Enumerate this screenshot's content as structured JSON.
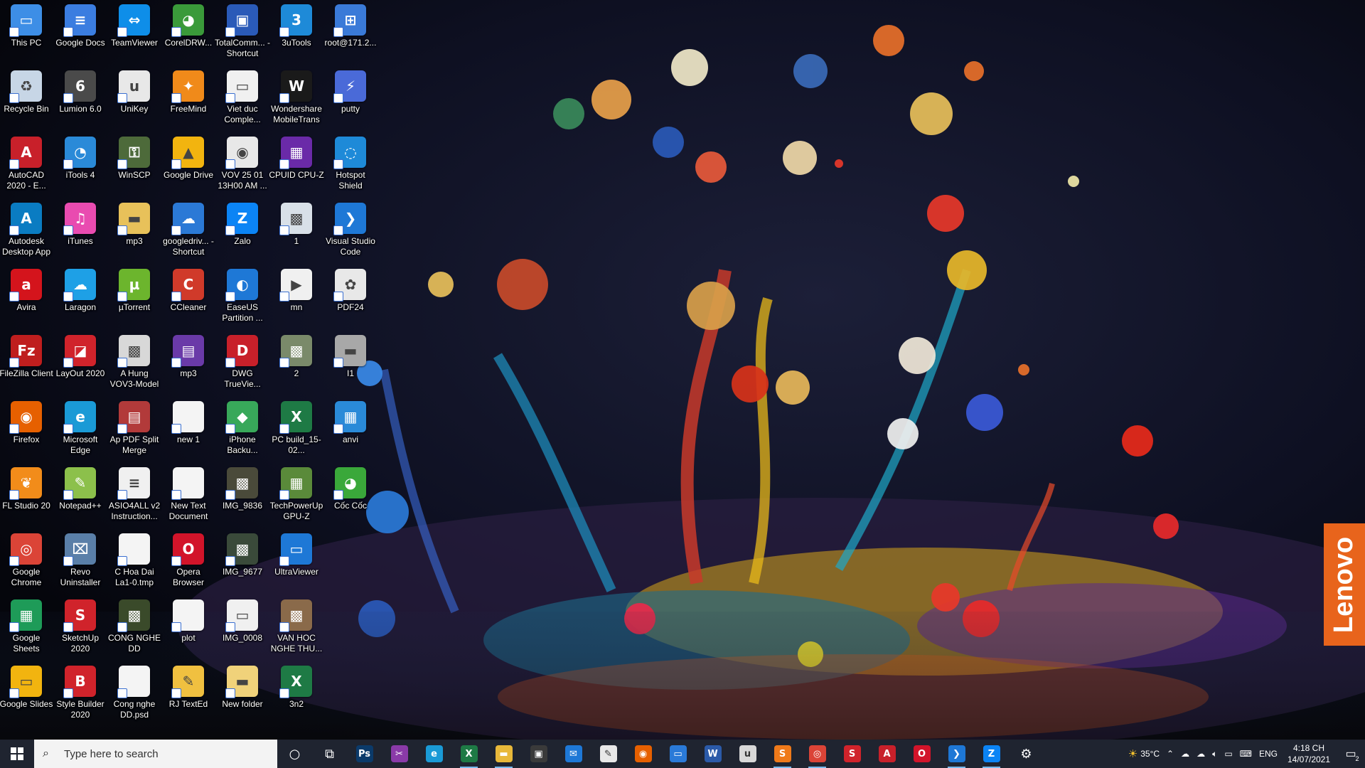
{
  "desktop": {
    "columns": [
      [
        {
          "label": "This PC",
          "icon": "this-pc-icon",
          "color": "#3d8ee6",
          "glyph": "▭"
        },
        {
          "label": "Recycle Bin",
          "icon": "recycle-bin-icon",
          "color": "#c7d6e6",
          "glyph": "♻"
        },
        {
          "label": "AutoCAD 2020 - E...",
          "icon": "autocad-icon",
          "color": "#c8202a",
          "glyph": "A"
        },
        {
          "label": "Autodesk Desktop App",
          "icon": "autodesk-icon",
          "color": "#0a7cc2",
          "glyph": "A"
        },
        {
          "label": "Avira",
          "icon": "avira-icon",
          "color": "#d4141c",
          "glyph": "a"
        },
        {
          "label": "FileZilla Client",
          "icon": "filezilla-icon",
          "color": "#bf1e1e",
          "glyph": "Fz"
        },
        {
          "label": "Firefox",
          "icon": "firefox-icon",
          "color": "#e66000",
          "glyph": "◉"
        },
        {
          "label": "FL Studio 20",
          "icon": "fl-studio-icon",
          "color": "#f28c1a",
          "glyph": "❦"
        },
        {
          "label": "Google Chrome",
          "icon": "chrome-icon",
          "color": "#db4437",
          "glyph": "◎"
        },
        {
          "label": "Google Sheets",
          "icon": "google-sheets-icon",
          "color": "#1e9b58",
          "glyph": "▦"
        },
        {
          "label": "Google Slides",
          "icon": "google-slides-icon",
          "color": "#f2b40f",
          "glyph": "▭"
        }
      ],
      [
        {
          "label": "Google Docs",
          "icon": "google-docs-icon",
          "color": "#3b7de0",
          "glyph": "≡"
        },
        {
          "label": "Lumion 6.0",
          "icon": "lumion-icon",
          "color": "#4a4a4a",
          "glyph": "6"
        },
        {
          "label": "iTools 4",
          "icon": "itools-icon",
          "color": "#2a8ad8",
          "glyph": "◔"
        },
        {
          "label": "iTunes",
          "icon": "itunes-icon",
          "color": "#e94bb0",
          "glyph": "♫"
        },
        {
          "label": "Laragon",
          "icon": "laragon-icon",
          "color": "#1ea0e6",
          "glyph": "☁"
        },
        {
          "label": "LayOut 2020",
          "icon": "layout-icon",
          "color": "#d0232b",
          "glyph": "◪"
        },
        {
          "label": "Microsoft Edge",
          "icon": "edge-icon",
          "color": "#1a9ad6",
          "glyph": "e"
        },
        {
          "label": "Notepad++",
          "icon": "notepadpp-icon",
          "color": "#8cc04b",
          "glyph": "✎"
        },
        {
          "label": "Revo Uninstaller",
          "icon": "revo-icon",
          "color": "#5a7fa8",
          "glyph": "⌧"
        },
        {
          "label": "SketchUp 2020",
          "icon": "sketchup-icon",
          "color": "#d0232b",
          "glyph": "S"
        },
        {
          "label": "Style Builder 2020",
          "icon": "style-builder-icon",
          "color": "#d0232b",
          "glyph": "B"
        }
      ],
      [
        {
          "label": "TeamViewer",
          "icon": "teamviewer-icon",
          "color": "#0e8ee9",
          "glyph": "⇔"
        },
        {
          "label": "UniKey",
          "icon": "unikey-icon",
          "color": "#e8e8e8",
          "glyph": "u"
        },
        {
          "label": "WinSCP",
          "icon": "winscp-icon",
          "color": "#4d6a3a",
          "glyph": "⚿"
        },
        {
          "label": "mp3",
          "icon": "folder-icon",
          "color": "#e8c15a",
          "glyph": "▬"
        },
        {
          "label": "µTorrent",
          "icon": "utorrent-icon",
          "color": "#6cb52d",
          "glyph": "µ"
        },
        {
          "label": "A Hung VOV3-Model",
          "icon": "image-file-icon",
          "color": "#d8d8d8",
          "glyph": "▩"
        },
        {
          "label": "Ap PDF Split Merge",
          "icon": "pdf-split-icon",
          "color": "#b23a3a",
          "glyph": "▤"
        },
        {
          "label": "ASIO4ALL v2 Instruction...",
          "icon": "document-icon",
          "color": "#f0f0f0",
          "glyph": "≡"
        },
        {
          "label": "C Hoa Dai La1-0.tmp",
          "icon": "file-icon",
          "color": "#f4f4f4",
          "glyph": " "
        },
        {
          "label": "CONG NGHE DD",
          "icon": "image-file-icon",
          "color": "#3a4a2a",
          "glyph": "▩"
        },
        {
          "label": "Cong nghe DD.psd",
          "icon": "file-icon",
          "color": "#f4f4f4",
          "glyph": " "
        }
      ],
      [
        {
          "label": "CorelDRW...",
          "icon": "coreldraw-icon",
          "color": "#3a9a3a",
          "glyph": "◕"
        },
        {
          "label": "FreeMind",
          "icon": "freemind-icon",
          "color": "#f08a1a",
          "glyph": "✦"
        },
        {
          "label": "Google Drive",
          "icon": "google-drive-icon",
          "color": "#f2b40f",
          "glyph": "▲"
        },
        {
          "label": "googledriv... - Shortcut",
          "icon": "cloud-icon",
          "color": "#2b79d6",
          "glyph": "☁"
        },
        {
          "label": "CCleaner",
          "icon": "ccleaner-icon",
          "color": "#d03a2a",
          "glyph": "C"
        },
        {
          "label": "mp3",
          "icon": "winrar-icon",
          "color": "#6a3aa8",
          "glyph": "▤"
        },
        {
          "label": "new 1",
          "icon": "file-icon",
          "color": "#f4f4f4",
          "glyph": " "
        },
        {
          "label": "New Text Document",
          "icon": "file-icon",
          "color": "#f4f4f4",
          "glyph": " "
        },
        {
          "label": "Opera Browser",
          "icon": "opera-icon",
          "color": "#d2142a",
          "glyph": "O"
        },
        {
          "label": "plot",
          "icon": "file-icon",
          "color": "#f4f4f4",
          "glyph": " "
        },
        {
          "label": "RJ TextEd",
          "icon": "rj-texted-icon",
          "color": "#f0c040",
          "glyph": "✎"
        }
      ],
      [
        {
          "label": "TotalComm... - Shortcut",
          "icon": "total-commander-icon",
          "color": "#2a5ab8",
          "glyph": "▣"
        },
        {
          "label": "Viet duc Comple...",
          "icon": "image-file-icon",
          "color": "#f0f0f0",
          "glyph": "▭"
        },
        {
          "label": "VOV 25 01 13H00 AM ...",
          "icon": "audio-file-icon",
          "color": "#e8e8e8",
          "glyph": "◉"
        },
        {
          "label": "Zalo",
          "icon": "zalo-icon",
          "color": "#0b84f5",
          "glyph": "Z"
        },
        {
          "label": "EaseUS Partition ...",
          "icon": "easeus-icon",
          "color": "#1e78d6",
          "glyph": "◐"
        },
        {
          "label": "DWG TrueVie...",
          "icon": "dwg-trueview-icon",
          "color": "#c8202a",
          "glyph": "D"
        },
        {
          "label": "iPhone Backu...",
          "icon": "iphone-backup-icon",
          "color": "#38a85a",
          "glyph": "◆"
        },
        {
          "label": "IMG_9836",
          "icon": "image-file-icon",
          "color": "#4a4a3a",
          "glyph": "▩"
        },
        {
          "label": "IMG_9677",
          "icon": "image-file-icon",
          "color": "#3a4a3a",
          "glyph": "▩"
        },
        {
          "label": "IMG_0008",
          "icon": "image-file-icon",
          "color": "#f0f0f0",
          "glyph": "▭"
        },
        {
          "label": "New folder",
          "icon": "folder-icon",
          "color": "#f0d27a",
          "glyph": "▬"
        }
      ],
      [
        {
          "label": "3uTools",
          "icon": "3utools-icon",
          "color": "#1e8ad8",
          "glyph": "3"
        },
        {
          "label": "Wondershare MobileTrans",
          "icon": "mobiletrans-icon",
          "color": "#1a1a1a",
          "glyph": "W"
        },
        {
          "label": "CPUID CPU-Z",
          "icon": "cpu-z-icon",
          "color": "#6a2aa8",
          "glyph": "▦"
        },
        {
          "label": "1",
          "icon": "image-file-icon",
          "color": "#d8e0e8",
          "glyph": "▩"
        },
        {
          "label": "mn",
          "icon": "video-file-icon",
          "color": "#f0f0f0",
          "glyph": "▶"
        },
        {
          "label": "2",
          "icon": "image-file-icon",
          "color": "#7a8a6a",
          "glyph": "▩"
        },
        {
          "label": "PC build_15-02...",
          "icon": "excel-file-icon",
          "color": "#1e7a45",
          "glyph": "X"
        },
        {
          "label": "TechPowerUp GPU-Z",
          "icon": "gpu-z-icon",
          "color": "#5a8a3a",
          "glyph": "▦"
        },
        {
          "label": "UltraViewer",
          "icon": "ultraviewer-icon",
          "color": "#1e78d6",
          "glyph": "▭"
        },
        {
          "label": "VAN HOC NGHE THU...",
          "icon": "image-file-icon",
          "color": "#8a6a4a",
          "glyph": "▩"
        },
        {
          "label": "3n2",
          "icon": "excel-file-icon",
          "color": "#1e7a45",
          "glyph": "X"
        }
      ],
      [
        {
          "label": "root@171.2...",
          "icon": "network-icon",
          "color": "#3a7ad8",
          "glyph": "⊞"
        },
        {
          "label": "putty",
          "icon": "putty-icon",
          "color": "#4a6ad8",
          "glyph": "⚡"
        },
        {
          "label": "Hotspot Shield",
          "icon": "hotspot-shield-icon",
          "color": "#1e8ad8",
          "glyph": "◌"
        },
        {
          "label": "Visual Studio Code",
          "icon": "vscode-icon",
          "color": "#1e78d6",
          "glyph": "❯"
        },
        {
          "label": "PDF24",
          "icon": "pdf24-icon",
          "color": "#e8e8e8",
          "glyph": "✿"
        },
        {
          "label": "I1",
          "icon": "image-file-icon",
          "color": "#a8a8a8",
          "glyph": "▬"
        },
        {
          "label": "anvi",
          "icon": "anvi-icon",
          "color": "#2a8ad8",
          "glyph": "▦"
        },
        {
          "label": "Cốc Cốc",
          "icon": "coccoc-icon",
          "color": "#3aa83a",
          "glyph": "◕"
        }
      ]
    ]
  },
  "lenovo": {
    "text": "Lenovo"
  },
  "taskbar": {
    "search_placeholder": "Type here to search",
    "apps": [
      {
        "name": "cortana-icon",
        "glyph": "○",
        "color": "transparent"
      },
      {
        "name": "task-view-icon",
        "glyph": "⧉",
        "color": "transparent"
      },
      {
        "name": "photoshop-icon",
        "glyph": "Ps",
        "color": "#0b3a6a"
      },
      {
        "name": "snipping-icon",
        "glyph": "✂",
        "color": "#8a3aa8"
      },
      {
        "name": "edge-icon",
        "glyph": "e",
        "color": "#1a9ad6"
      },
      {
        "name": "excel-icon",
        "glyph": "X",
        "color": "#1e7a45",
        "active": true
      },
      {
        "name": "file-explorer-icon",
        "glyph": "▬",
        "color": "#e8b83a",
        "active": true
      },
      {
        "name": "store-icon",
        "glyph": "▣",
        "color": "#3a3a3a"
      },
      {
        "name": "mail-icon",
        "glyph": "✉",
        "color": "#1e78d6"
      },
      {
        "name": "paint-icon",
        "glyph": "✎",
        "color": "#e8e8e8"
      },
      {
        "name": "firefox-icon",
        "glyph": "◉",
        "color": "#e66000"
      },
      {
        "name": "remote-desktop-icon",
        "glyph": "▭",
        "color": "#2a7ad8"
      },
      {
        "name": "word-icon",
        "glyph": "W",
        "color": "#2b5aa8"
      },
      {
        "name": "unikey-icon",
        "glyph": "u",
        "color": "#d8d8d8"
      },
      {
        "name": "sublime-icon",
        "glyph": "S",
        "color": "#ef7a1a",
        "active": true
      },
      {
        "name": "chrome-icon",
        "glyph": "◎",
        "color": "#db4437",
        "active": true
      },
      {
        "name": "sketchup-icon",
        "glyph": "S",
        "color": "#d0232b"
      },
      {
        "name": "autocad-icon",
        "glyph": "A",
        "color": "#c8202a"
      },
      {
        "name": "opera-icon",
        "glyph": "O",
        "color": "#d2142a"
      },
      {
        "name": "vscode-icon",
        "glyph": "❯",
        "color": "#1e78d6",
        "active": true
      },
      {
        "name": "zalo-icon",
        "glyph": "Z",
        "color": "#0b84f5",
        "active": true
      },
      {
        "name": "settings-icon",
        "glyph": "⚙",
        "color": "transparent"
      }
    ],
    "tray": {
      "temperature": "35°C",
      "language": "ENG",
      "time": "4:18 CH",
      "date": "14/07/2021",
      "notification_count": "2"
    }
  }
}
